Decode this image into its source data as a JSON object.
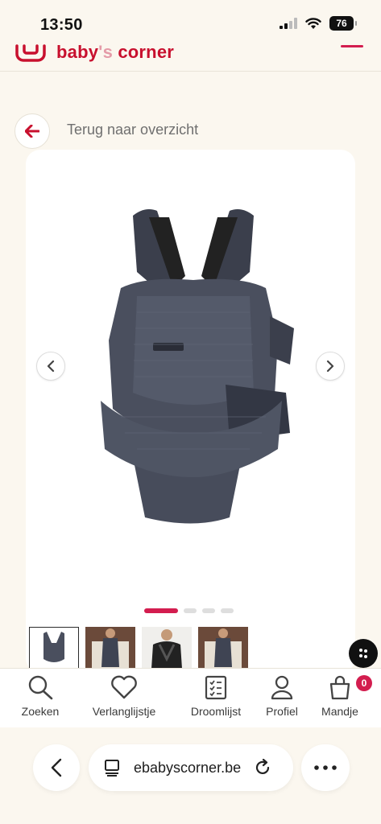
{
  "status_bar": {
    "time": "13:50",
    "battery": "76"
  },
  "header": {
    "logo_text": [
      "baby",
      "'s ",
      "corner"
    ]
  },
  "back": {
    "label": "Terug naar overzicht"
  },
  "carousel": {
    "slide_count": 4,
    "active_index": 0,
    "thumbnail_count": 4,
    "selected_thumbnail": 0
  },
  "bottom_nav": {
    "items": [
      {
        "label": "Zoeken",
        "icon": "search-icon"
      },
      {
        "label": "Verlanglijstje",
        "icon": "heart-icon"
      },
      {
        "label": "Droomlijst",
        "icon": "checklist-icon"
      },
      {
        "label": "Profiel",
        "icon": "user-icon"
      },
      {
        "label": "Mandje",
        "icon": "basket-icon"
      }
    ],
    "cart_count": "0"
  },
  "browser": {
    "url": "ebabyscorner.be"
  },
  "colors": {
    "accent": "#d31d4f",
    "background": "#fbf7ef",
    "carrier": "#4a4f5e"
  }
}
